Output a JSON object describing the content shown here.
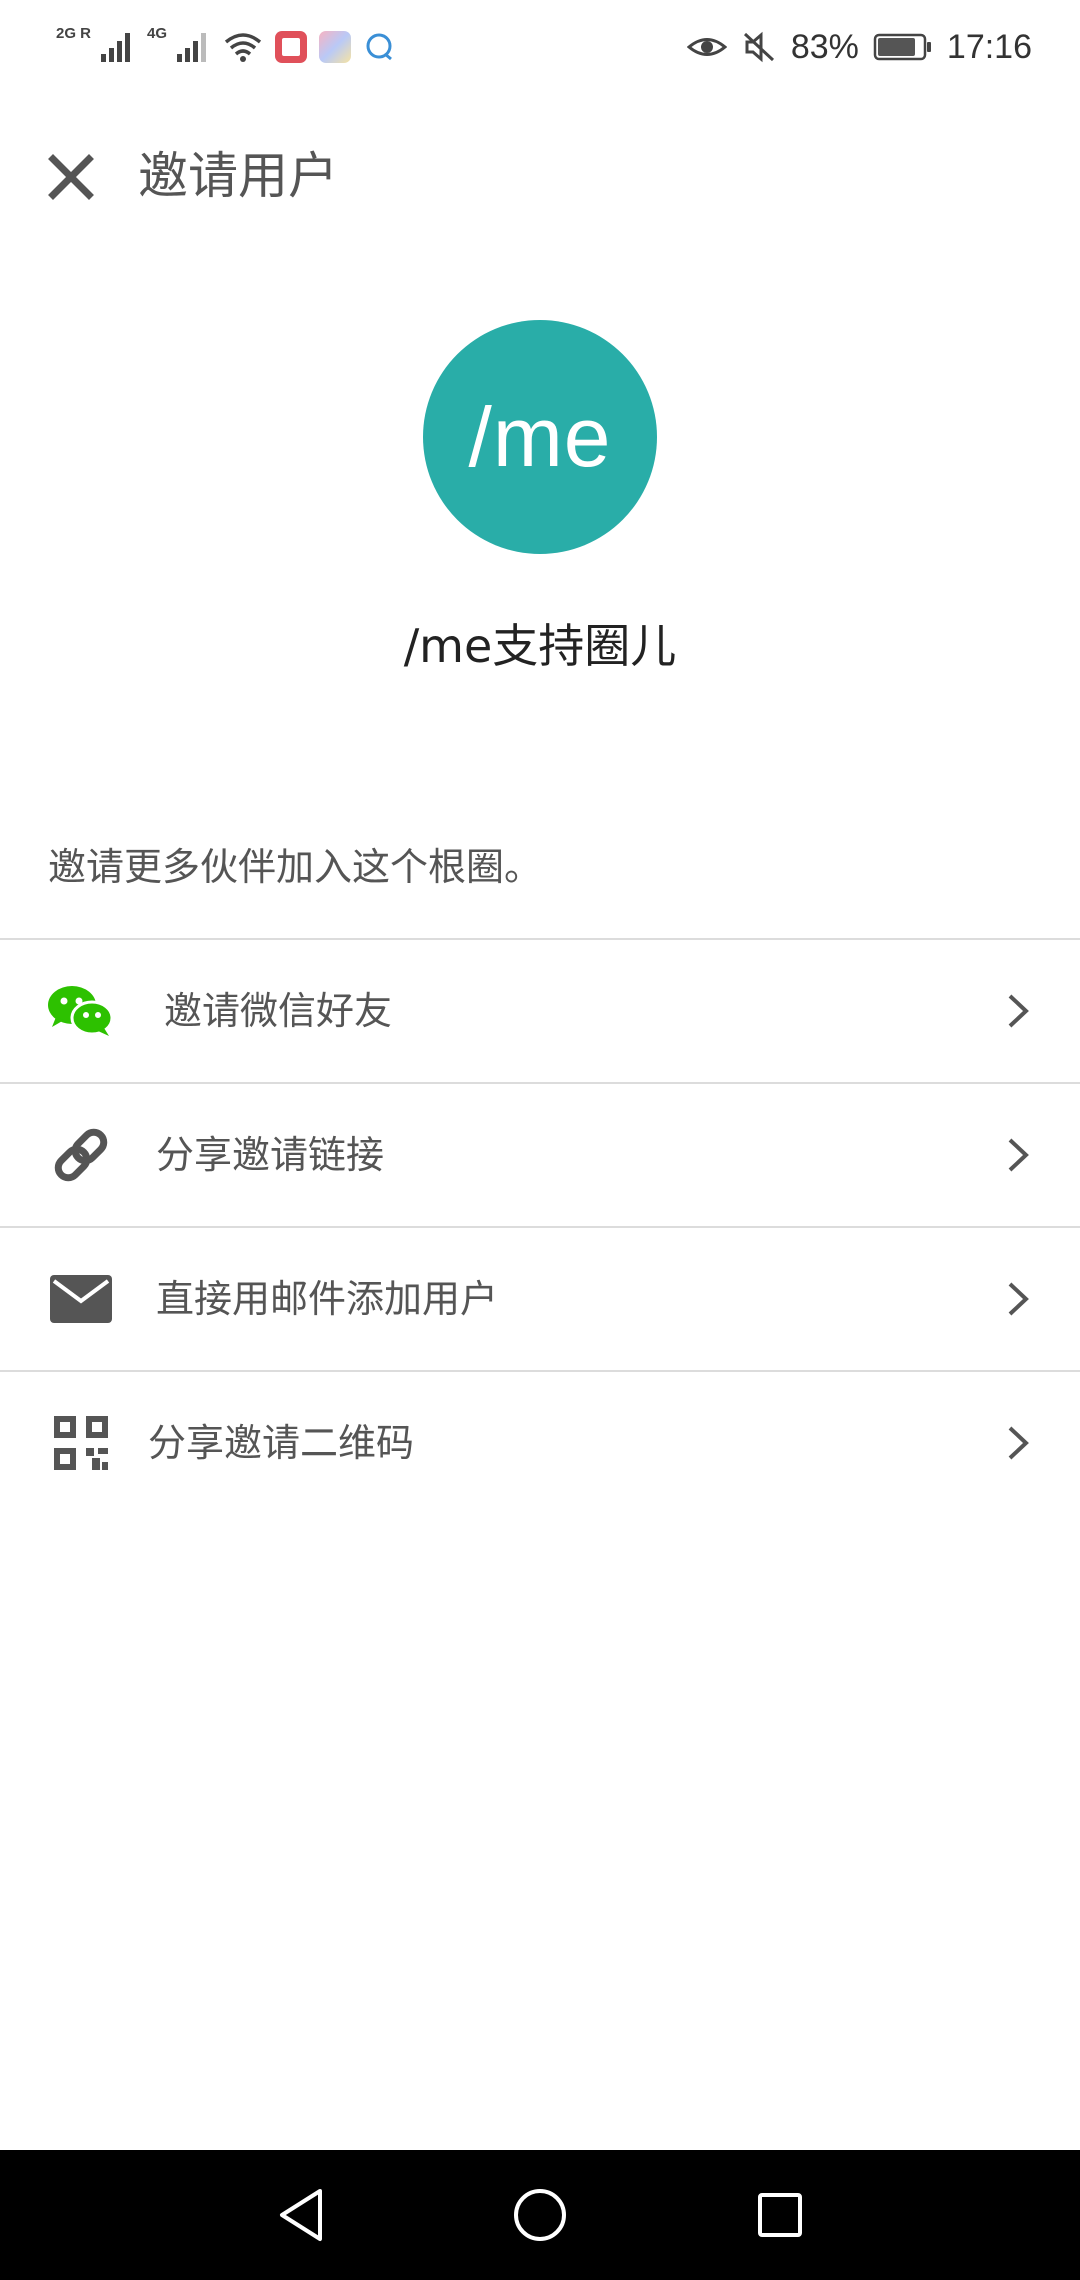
{
  "status_bar": {
    "signal1_label": "2G R",
    "signal2_label": "4G",
    "battery_percent": "83%",
    "battery_level": 0.83,
    "time": "17:16",
    "icons": [
      "signal-icon",
      "wifi-icon",
      "book-app-icon",
      "gallery-app-icon",
      "chat-app-icon",
      "eye-comfort-icon",
      "mute-icon",
      "battery-icon"
    ]
  },
  "header": {
    "title": "邀请用户",
    "close_icon": "close-icon"
  },
  "circle": {
    "avatar_text": "/me",
    "avatar_color": "#29ada8",
    "name": "/me支持圈儿"
  },
  "description": "邀请更多伙伴加入这个根圈。",
  "options": [
    {
      "label": "邀请微信好友",
      "icon": "wechat-icon",
      "icon_color": "#2dc100"
    },
    {
      "label": "分享邀请链接",
      "icon": "link-icon",
      "icon_color": "#555555"
    },
    {
      "label": "直接用邮件添加用户",
      "icon": "mail-icon",
      "icon_color": "#555555"
    },
    {
      "label": "分享邀请二维码",
      "icon": "qr-code-icon",
      "icon_color": "#555555"
    }
  ],
  "nav_bar": {
    "buttons": [
      "back-icon",
      "home-icon",
      "recents-icon"
    ]
  }
}
